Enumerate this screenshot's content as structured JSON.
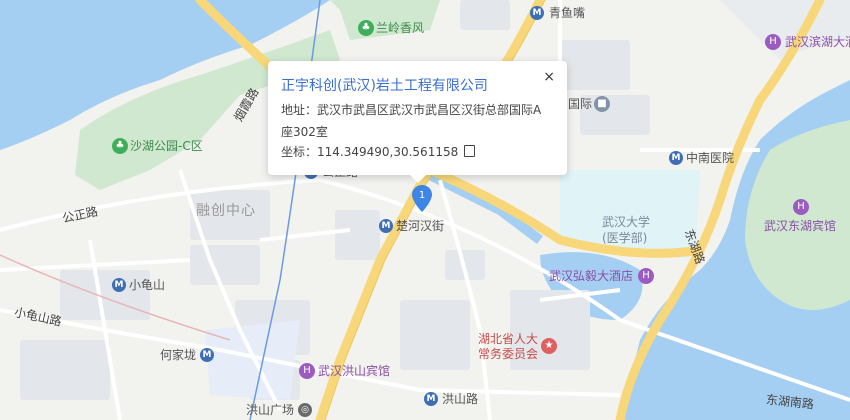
{
  "map": {
    "colors": {
      "water": "#a4cff3",
      "park": "#cfe8cf",
      "block": "#e3e6ea",
      "major_road": "#f7d77a",
      "road": "#ffffff",
      "land": "#f2f2ef"
    },
    "labels": {
      "lanling": "兰岭香风",
      "qingyuzui": "青鱼嘴",
      "binhu_hotel": "武汉滨湖大酒店",
      "shahu_park": "沙湖公园-C区",
      "yanxia_road": "烟霞路",
      "gongzheng_road_metro": "公正路",
      "gongzheng_road": "公正路",
      "rongchuang": "融创中心",
      "chuhehan": "楚河汉街",
      "zhongnan_hospital": "中南医院",
      "whu_medical_line1": "武汉大学",
      "whu_medical_line2": "(医学部)",
      "donghu_hotel": "武汉东湖宾馆",
      "donghu_road": "东湖路",
      "hongyi_hotel": "武汉弘毅大酒店",
      "xiaoguishan": "小龟山",
      "xiaoguishan_road": "小龟山路",
      "npc_line1": "湖北省人大",
      "npc_line2": "常务委员会",
      "hejiapo": "何家垅",
      "hongshan_hotel": "武汉洪山宾馆",
      "hongshan_road": "洪山路",
      "hongshan_square": "洪山广场",
      "donghu_south_road": "东湖南路",
      "intl_partial": "国际"
    }
  },
  "popup": {
    "title": "正宇科创(武汉)岩土工程有限公司",
    "close": "×",
    "address": "地址：武汉市武昌区武汉市武昌区汉街总部国际A座302室",
    "coord": "坐标：114.349490,30.561158"
  },
  "marker": {
    "number": "1",
    "color": "#3d86e8"
  }
}
